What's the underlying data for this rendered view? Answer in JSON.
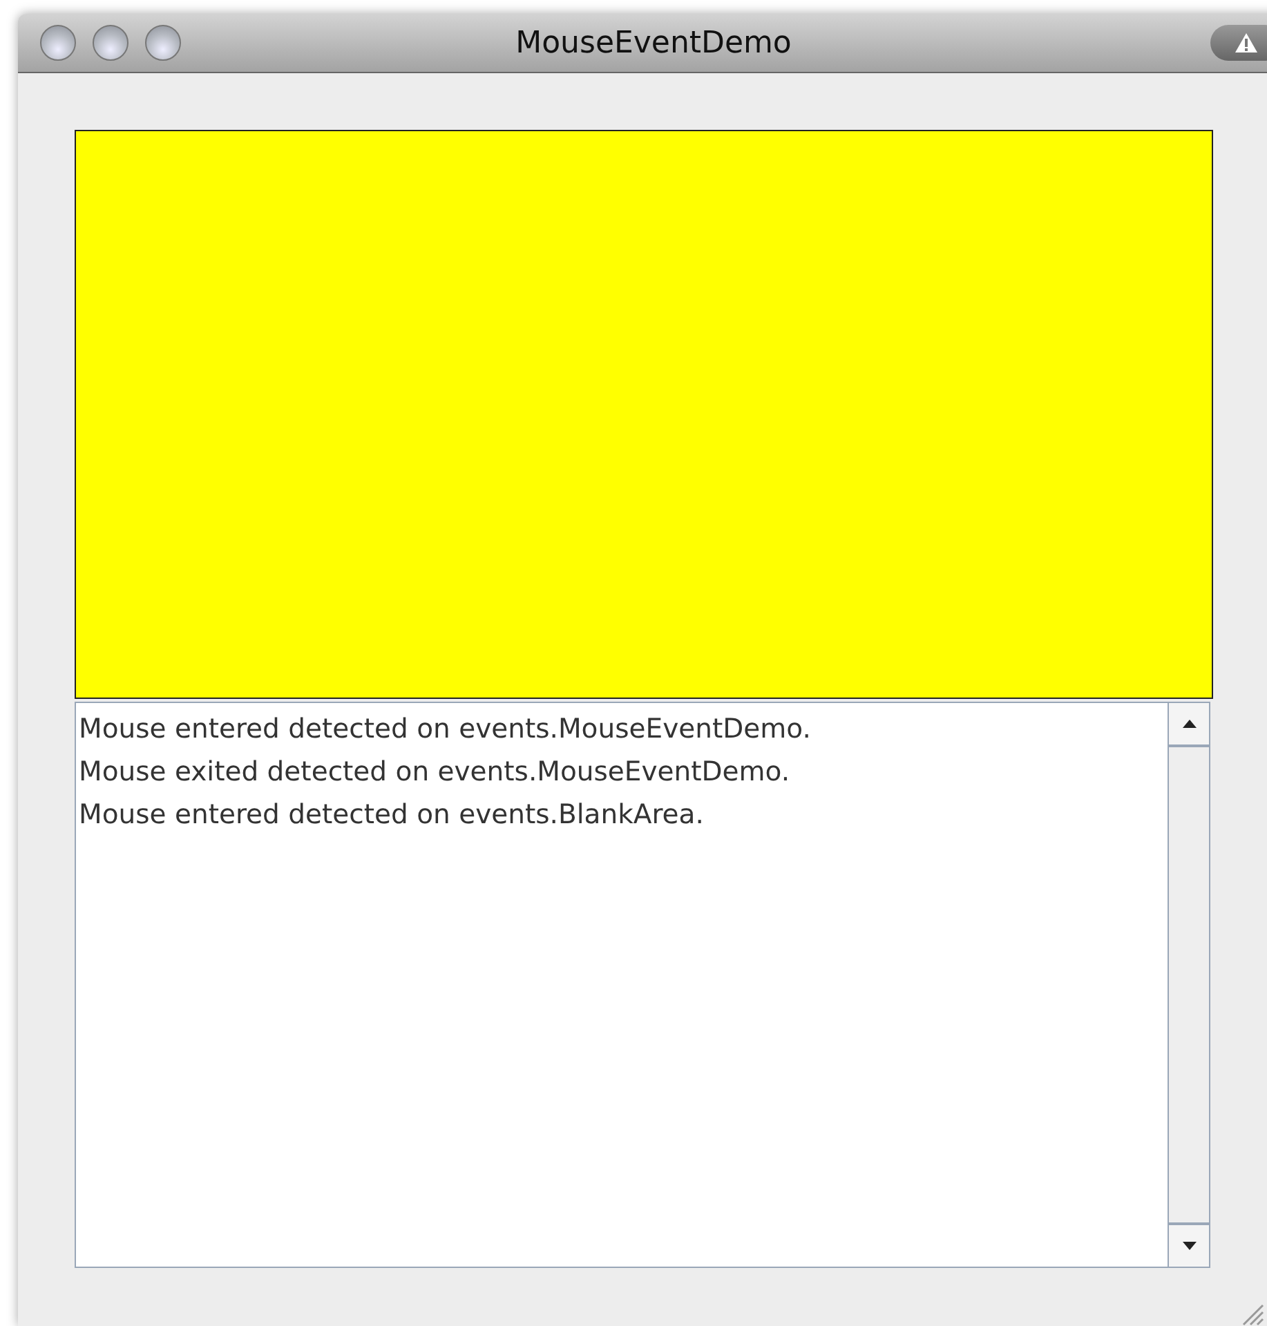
{
  "window": {
    "title": "MouseEventDemo"
  },
  "blank_area": {
    "color": "#ffff00"
  },
  "log": {
    "lines": [
      "Mouse entered detected on events.MouseEventDemo.",
      "Mouse exited detected on events.MouseEventDemo.",
      "Mouse entered detected on events.BlankArea."
    ]
  }
}
